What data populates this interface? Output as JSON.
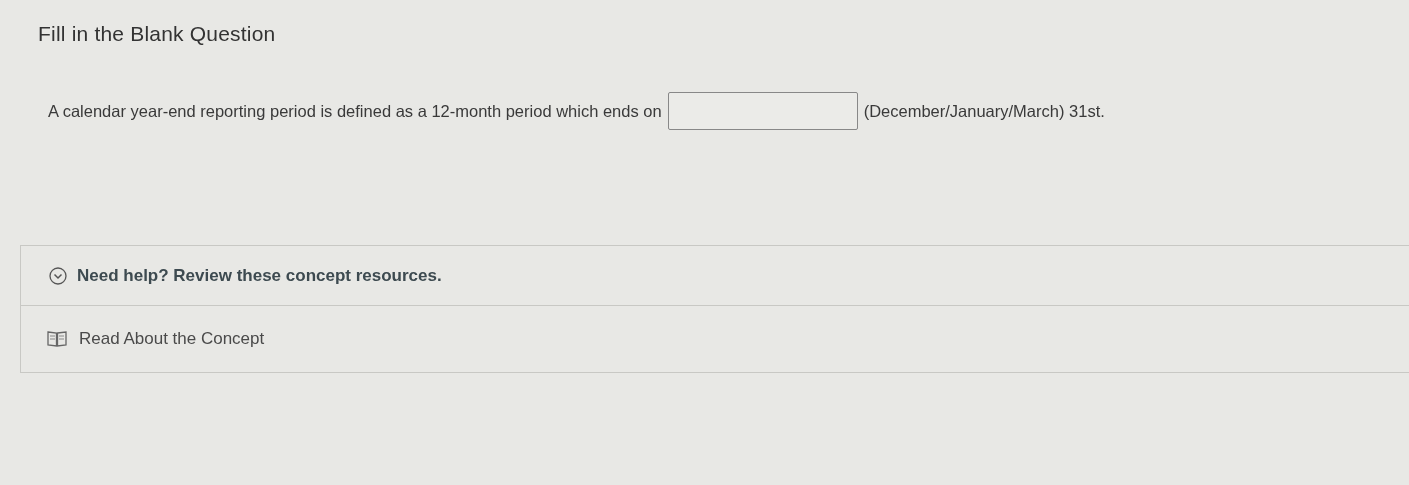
{
  "question": {
    "title": "Fill in the Blank Question",
    "text_before": "A calendar year-end reporting period is defined as a 12-month period which ends on",
    "text_after": "(December/January/March) 31st."
  },
  "help": {
    "title": "Need help? Review these concept resources.",
    "expanded": true,
    "resources": [
      {
        "label": "Read About the Concept"
      }
    ]
  }
}
